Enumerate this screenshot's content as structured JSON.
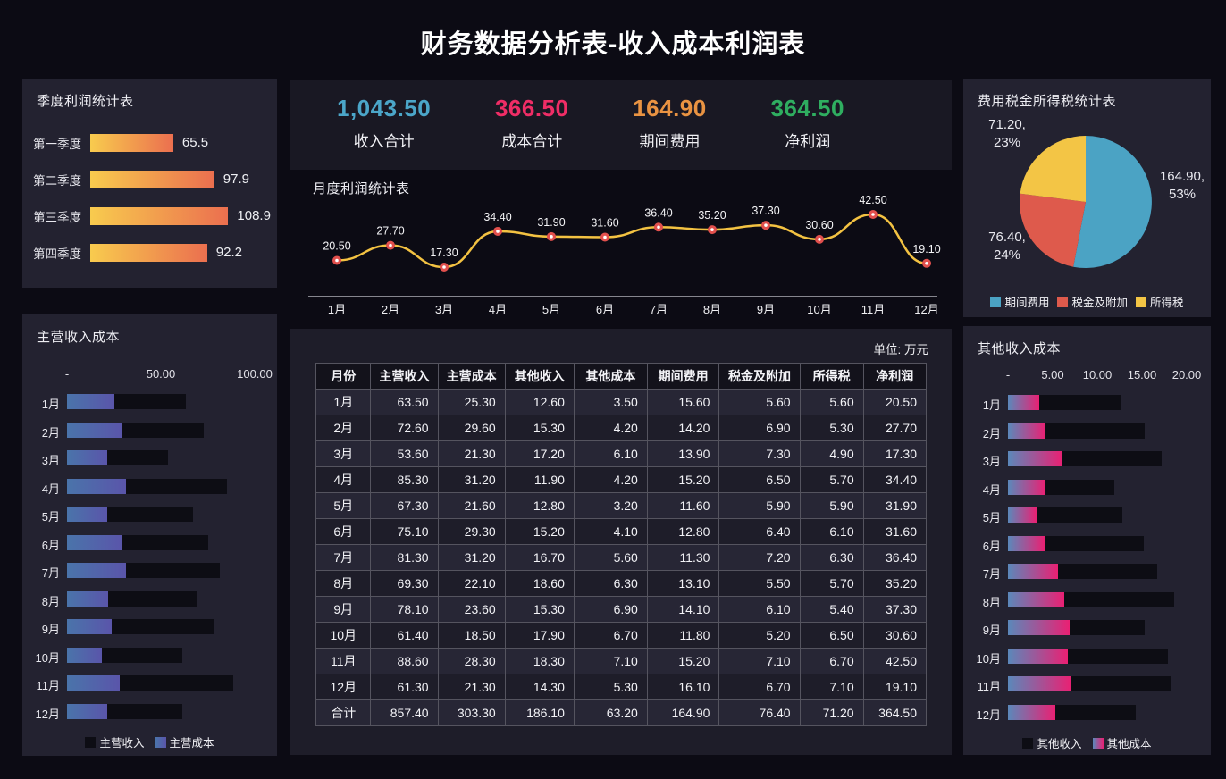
{
  "page_title": "财务数据分析表-收入成本利润表",
  "kpi": {
    "items": [
      {
        "value": "1,043.50",
        "label": "收入合计",
        "color": "#4ba6c9"
      },
      {
        "value": "366.50",
        "label": "成本合计",
        "color": "#ef2d66"
      },
      {
        "value": "164.90",
        "label": "期间费用",
        "color": "#e99342"
      },
      {
        "value": "364.50",
        "label": "净利润",
        "color": "#2fae60"
      }
    ]
  },
  "chart_data": [
    {
      "id": "quarterly_profit",
      "type": "bar",
      "title": "季度利润统计表",
      "orientation": "horizontal",
      "categories": [
        "第一季度",
        "第二季度",
        "第三季度",
        "第四季度"
      ],
      "values": [
        65.5,
        97.9,
        108.9,
        92.2
      ],
      "value_labels": [
        "65.5",
        "97.9",
        "108.9",
        "92.2"
      ],
      "xlim": [
        0,
        110
      ],
      "bar_gradient": [
        "#f8cb4e",
        "#eb6f4f"
      ]
    },
    {
      "id": "monthly_profit",
      "type": "line",
      "title": "月度利润统计表",
      "x": [
        "1月",
        "2月",
        "3月",
        "4月",
        "5月",
        "6月",
        "7月",
        "8月",
        "9月",
        "10月",
        "11月",
        "12月"
      ],
      "values": [
        20.5,
        27.7,
        17.3,
        34.4,
        31.9,
        31.6,
        36.4,
        35.2,
        37.3,
        30.6,
        42.5,
        19.1
      ],
      "value_labels": [
        "20.50",
        "27.70",
        "17.30",
        "34.40",
        "31.90",
        "31.60",
        "36.40",
        "35.20",
        "37.30",
        "30.60",
        "42.50",
        "19.10"
      ],
      "line_color": "#f3c242",
      "marker_color": "#e2504d",
      "smooth": true
    },
    {
      "id": "tax_expense_pie",
      "type": "pie",
      "title": "费用税金所得税统计表",
      "slices": [
        {
          "label": "期间费用",
          "value": 164.9,
          "pct": 53,
          "color": "#4ba3c4",
          "callout": [
            "164.90,",
            "53%"
          ],
          "callout_pos": "right"
        },
        {
          "label": "税金及附加",
          "value": 76.4,
          "pct": 24,
          "color": "#de5a4c",
          "callout": [
            "76.40,",
            "24%"
          ],
          "callout_pos": "bottom-left"
        },
        {
          "label": "所得税",
          "value": 71.2,
          "pct": 23,
          "color": "#f3c545",
          "callout": [
            "71.20,",
            "23%"
          ],
          "callout_pos": "top-left"
        }
      ],
      "legend_position": "bottom"
    },
    {
      "id": "main_income_cost",
      "type": "bar",
      "title": "主营收入成本",
      "orientation": "horizontal",
      "categories": [
        "1月",
        "2月",
        "3月",
        "4月",
        "5月",
        "6月",
        "7月",
        "8月",
        "9月",
        "10月",
        "11月",
        "12月"
      ],
      "axis_ticks": [
        "-",
        "50.00",
        "100.00"
      ],
      "xlim": [
        0,
        100
      ],
      "series": [
        {
          "name": "主营收入",
          "color": "#0d0d14",
          "values": [
            63.5,
            72.6,
            53.6,
            85.3,
            67.3,
            75.1,
            81.3,
            69.3,
            78.1,
            61.4,
            88.6,
            61.3
          ]
        },
        {
          "name": "主营成本",
          "gradient": [
            "#4a74aa",
            "#5a55aa"
          ],
          "values": [
            25.3,
            29.6,
            21.3,
            31.2,
            21.6,
            29.3,
            31.2,
            22.1,
            23.6,
            18.5,
            28.3,
            21.3
          ]
        }
      ]
    },
    {
      "id": "other_income_cost",
      "type": "bar",
      "title": "其他收入成本",
      "orientation": "horizontal",
      "categories": [
        "1月",
        "2月",
        "3月",
        "4月",
        "5月",
        "6月",
        "7月",
        "8月",
        "9月",
        "10月",
        "11月",
        "12月"
      ],
      "axis_ticks": [
        "-",
        "5.00",
        "10.00",
        "15.00",
        "20.00"
      ],
      "xlim": [
        0,
        20
      ],
      "series": [
        {
          "name": "其他收入",
          "color": "#0d0d14",
          "values": [
            12.6,
            15.3,
            17.2,
            11.9,
            12.8,
            15.2,
            16.7,
            18.6,
            15.3,
            17.9,
            18.3,
            14.3
          ]
        },
        {
          "name": "其他成本",
          "gradient": [
            "#5b88ba",
            "#ea2073"
          ],
          "values": [
            3.5,
            4.2,
            6.1,
            4.2,
            3.2,
            4.1,
            5.6,
            6.3,
            6.9,
            6.7,
            7.1,
            5.3
          ]
        }
      ]
    },
    {
      "id": "monthly_table",
      "type": "table",
      "unit_label": "单位: 万元",
      "headers": [
        "月份",
        "主营收入",
        "主营成本",
        "其他收入",
        "其他成本",
        "期间费用",
        "税金及附加",
        "所得税",
        "净利润"
      ],
      "rows": [
        [
          "1月",
          "63.50",
          "25.30",
          "12.60",
          "3.50",
          "15.60",
          "5.60",
          "5.60",
          "20.50"
        ],
        [
          "2月",
          "72.60",
          "29.60",
          "15.30",
          "4.20",
          "14.20",
          "6.90",
          "5.30",
          "27.70"
        ],
        [
          "3月",
          "53.60",
          "21.30",
          "17.20",
          "6.10",
          "13.90",
          "7.30",
          "4.90",
          "17.30"
        ],
        [
          "4月",
          "85.30",
          "31.20",
          "11.90",
          "4.20",
          "15.20",
          "6.50",
          "5.70",
          "34.40"
        ],
        [
          "5月",
          "67.30",
          "21.60",
          "12.80",
          "3.20",
          "11.60",
          "5.90",
          "5.90",
          "31.90"
        ],
        [
          "6月",
          "75.10",
          "29.30",
          "15.20",
          "4.10",
          "12.80",
          "6.40",
          "6.10",
          "31.60"
        ],
        [
          "7月",
          "81.30",
          "31.20",
          "16.70",
          "5.60",
          "11.30",
          "7.20",
          "6.30",
          "36.40"
        ],
        [
          "8月",
          "69.30",
          "22.10",
          "18.60",
          "6.30",
          "13.10",
          "5.50",
          "5.70",
          "35.20"
        ],
        [
          "9月",
          "78.10",
          "23.60",
          "15.30",
          "6.90",
          "14.10",
          "6.10",
          "5.40",
          "37.30"
        ],
        [
          "10月",
          "61.40",
          "18.50",
          "17.90",
          "6.70",
          "11.80",
          "5.20",
          "6.50",
          "30.60"
        ],
        [
          "11月",
          "88.60",
          "28.30",
          "18.30",
          "7.10",
          "15.20",
          "7.10",
          "6.70",
          "42.50"
        ],
        [
          "12月",
          "61.30",
          "21.30",
          "14.30",
          "5.30",
          "16.10",
          "6.70",
          "7.10",
          "19.10"
        ],
        [
          "合计",
          "857.40",
          "303.30",
          "186.10",
          "63.20",
          "164.90",
          "76.40",
          "71.20",
          "364.50"
        ]
      ]
    }
  ]
}
